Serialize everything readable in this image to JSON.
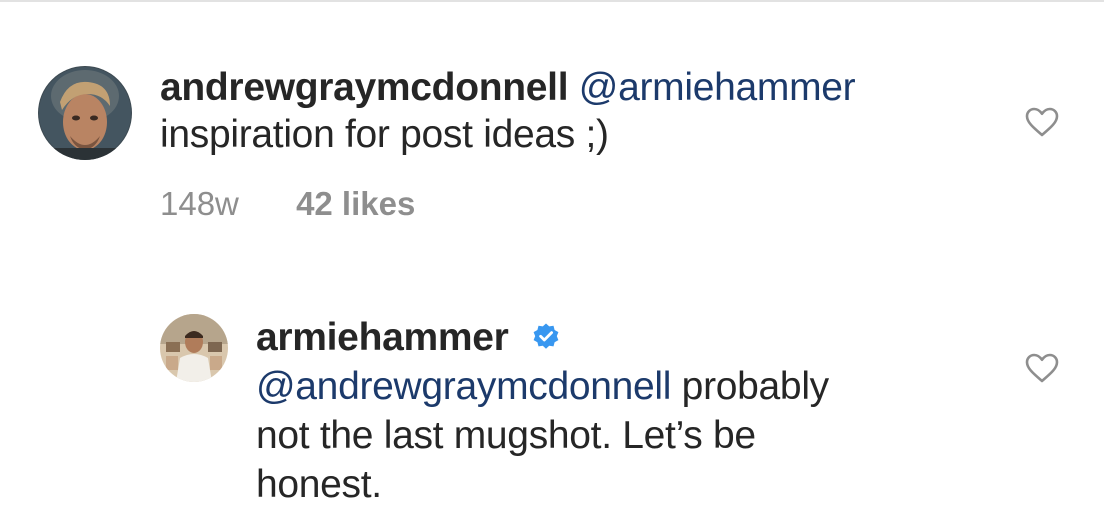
{
  "comments": [
    {
      "username": "andrewgraymcdonnell",
      "mention": "@armiehammer",
      "text": "inspiration for post ideas ;)",
      "age": "148w",
      "likes": "42 likes",
      "avatar_icon": "profile-photo",
      "like_icon": "heart-outline-icon"
    }
  ],
  "replies": [
    {
      "username": "armiehammer",
      "verified": true,
      "verified_icon": "verified-badge-icon",
      "verified_color": "#3897f0",
      "mention": "@andrewgraymcdonnell",
      "text_line1": " probably",
      "text_line2": "not the last mugshot. Let’s be",
      "text_line3": "honest.",
      "avatar_icon": "profile-photo",
      "like_icon": "heart-outline-icon"
    }
  ],
  "colors": {
    "text": "#262626",
    "mention": "#1c3a6b",
    "secondary": "#8e8e8e",
    "divider": "#e2e2e2"
  }
}
